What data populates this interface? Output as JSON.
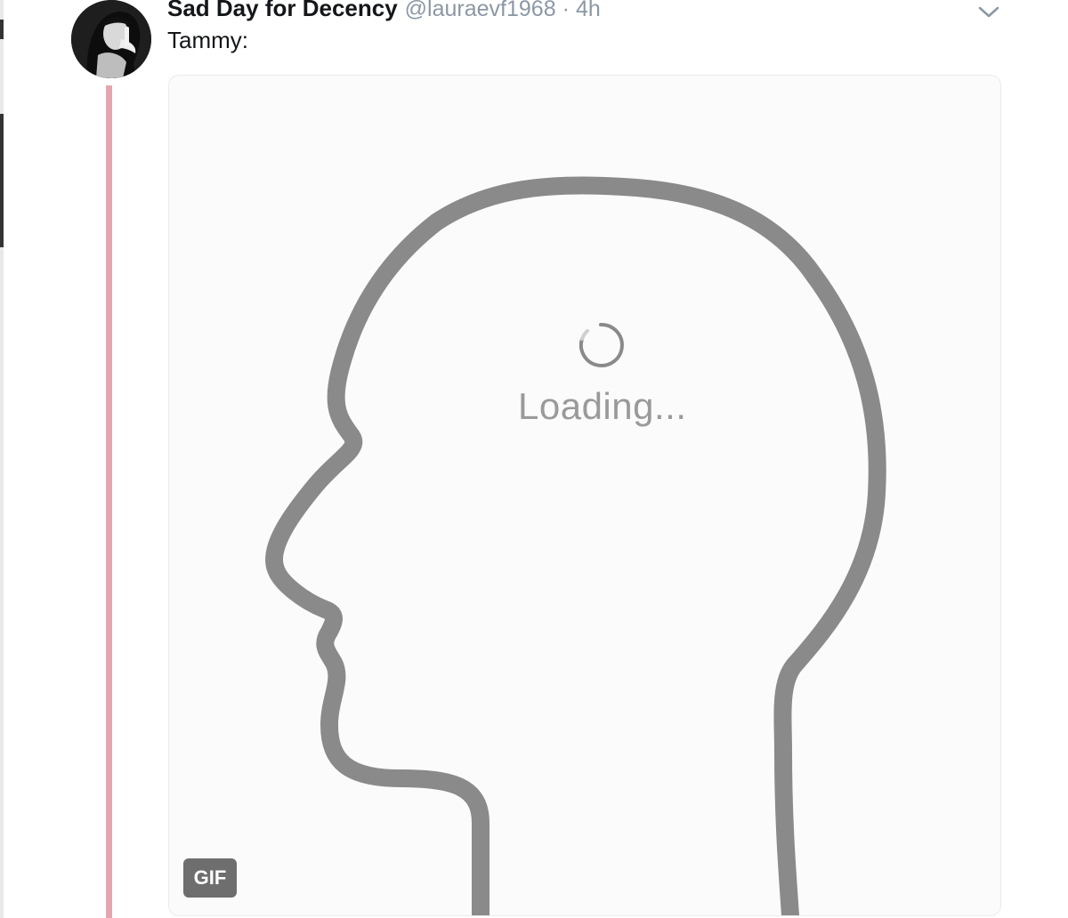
{
  "tweet": {
    "display_name": "Sad Day for Decency",
    "handle": "@lauraevf1968",
    "separator": "·",
    "time": "4h",
    "text": "Tammy:"
  },
  "media": {
    "loading_text": "Loading...",
    "badge": "GIF"
  },
  "icons": {
    "caret": "chevron-down-icon",
    "spinner": "loading-spinner-icon"
  },
  "colors": {
    "thread_line": "#e3a6b1",
    "head_outline": "#8a8a8a",
    "muted_text": "#8b98a5"
  }
}
